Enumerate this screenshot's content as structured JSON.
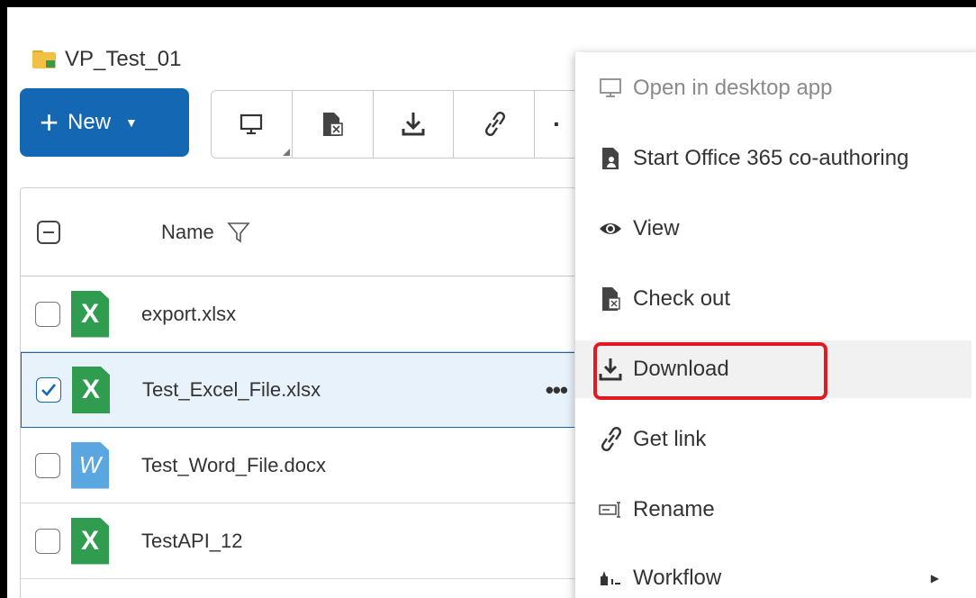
{
  "folder": {
    "name": "VP_Test_01",
    "icon": "folder-icon"
  },
  "toolbar": {
    "new_label": "New",
    "buttons": [
      {
        "icon": "desktop-icon"
      },
      {
        "icon": "checkout-icon"
      },
      {
        "icon": "download-icon"
      },
      {
        "icon": "link-icon"
      },
      {
        "icon": "more-icon",
        "text": "·"
      }
    ]
  },
  "list": {
    "header": {
      "name_label": "Name"
    },
    "rows": [
      {
        "name": "export.xlsx",
        "type": "excel",
        "icon_letter": "X",
        "checked": false
      },
      {
        "name": "Test_Excel_File.xlsx",
        "type": "excel",
        "icon_letter": "X",
        "checked": true,
        "more": "•••"
      },
      {
        "name": "Test_Word_File.docx",
        "type": "word",
        "icon_letter": "W",
        "checked": false
      },
      {
        "name": "TestAPI_12",
        "type": "excel",
        "icon_letter": "X",
        "checked": false
      }
    ]
  },
  "context_menu": {
    "items": [
      {
        "label": "Open in desktop app",
        "icon": "desktop-icon",
        "disabled": true
      },
      {
        "label": "Start Office 365 co-authoring",
        "icon": "coauthor-icon"
      },
      {
        "label": "View",
        "icon": "eye-icon"
      },
      {
        "label": "Check out",
        "icon": "checkout-icon"
      },
      {
        "label": "Download",
        "icon": "download-icon",
        "highlighted": true
      },
      {
        "label": "Get link",
        "icon": "link-icon"
      },
      {
        "label": "Rename",
        "icon": "rename-icon"
      },
      {
        "label": "Workflow",
        "icon": "workflow-icon",
        "has_submenu": true
      }
    ]
  },
  "colors": {
    "accent": "#1367b3",
    "highlight": "#e11b22",
    "excel": "#2f9c4f",
    "word": "#5aa6e0"
  }
}
